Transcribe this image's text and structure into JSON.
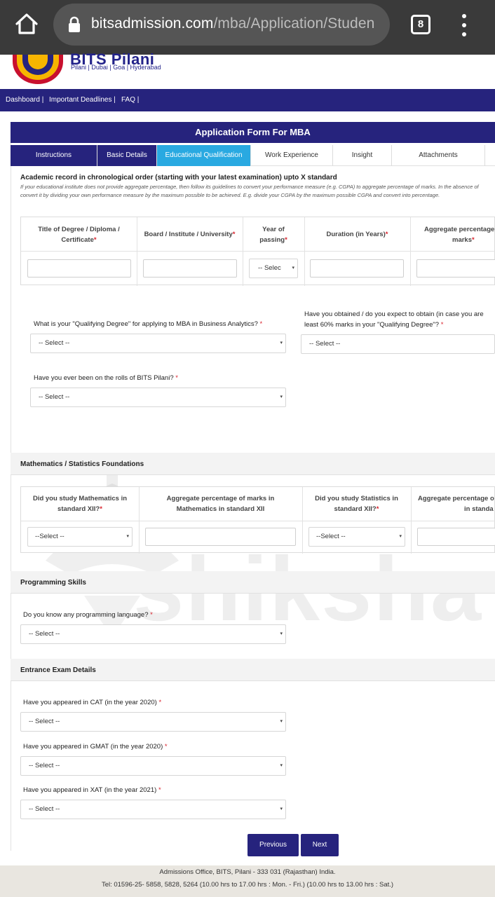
{
  "browser": {
    "url_host": "bitsadmission.com",
    "url_path": "/mba/Application/Studen",
    "tab_count": "8",
    "icons": [
      "home-icon",
      "lock-icon",
      "tabs-icon",
      "menu-icon"
    ]
  },
  "site": {
    "logo_title": "BITS Pilani",
    "logo_sub": "Pilani | Dubai | Goa | Hyderabad",
    "nav": [
      "Dashboard |",
      "Important Deadlines |",
      "FAQ |"
    ]
  },
  "form": {
    "title": "Application Form For MBA",
    "tabs": [
      "Instructions",
      "Basic Details",
      "Educational Qualification",
      "Work Experience",
      "Insight",
      "Attachments"
    ],
    "active_tab": "Educational Qualification"
  },
  "academic": {
    "heading": "Academic record in chronological order (starting with your latest examination) upto X standard",
    "note_line1": "If your educational institute does not provide aggregate percentage, then follow its guidelines to convert your performance measure (e.g. CGPA) to aggregate percentage of marks. In the absence of",
    "note_line2": "convert it by dividing your own performance measure by the maximum possible to be achieved. E.g. divide your CGPA by the maximum possible CGPA and convert into percentage.",
    "columns": [
      {
        "line1": "Title of Degree / Diploma /",
        "line2": "Certificate"
      },
      {
        "line1": "Board / Institute / University",
        "line2": ""
      },
      {
        "line1": "Year of",
        "line2": "passing"
      },
      {
        "line1": "Duration (in Years)",
        "line2": ""
      },
      {
        "line1": "Aggregate percentage",
        "line2": "marks"
      }
    ],
    "year_select": "-- Selec"
  },
  "qualifying": {
    "q1": "What is your \"Qualifying Degree\" for applying to MBA in Business Analytics?",
    "q1_value": "-- Select --",
    "q2_line1": "Have you obtained / do you expect to obtain (in case you are",
    "q2_line2": "least 60% marks in your \"Qualifying Degree\"?",
    "q2_value": "-- Select --",
    "q3": "Have you ever been on the rolls of BITS Pilani?",
    "q3_value": "-- Select --"
  },
  "maths": {
    "heading": "Mathematics / Statistics Foundations",
    "columns": [
      {
        "line1": "Did you study Mathematics in",
        "line2": "standard XII?"
      },
      {
        "line1": "Aggregate percentage of marks in",
        "line2": "Mathematics in standard XII"
      },
      {
        "line1": "Did you study Statistics in",
        "line2": "standard XII?"
      },
      {
        "line1": "Aggregate percentage o",
        "line2": "in standa"
      }
    ],
    "math_value": "--Select --",
    "stat_value": "--Select --"
  },
  "programming": {
    "heading": "Programming Skills",
    "q": "Do you know any programming language?",
    "value": "-- Select --"
  },
  "entrance": {
    "heading": "Entrance Exam Details",
    "cat_q": "Have you appeared in CAT (in the year 2020)",
    "cat_value": "-- Select --",
    "gmat_q": "Have you appeared in GMAT (in the year 2020)",
    "gmat_value": "-- Select --",
    "xat_q": "Have you appeared in XAT (in the year 2021)",
    "xat_value": "-- Select --"
  },
  "buttons": {
    "previous": "Previous",
    "next": "Next"
  },
  "footer": {
    "line1": "Admissions Office, BITS, Pilani - 333 031 (Rajasthan) India.",
    "line2": "Tel: 01596-25- 5858, 5828, 5264 (10.00 hrs to 17.00 hrs : Mon. - Fri.) (10.00 hrs to 13.00 hrs : Sat.)"
  },
  "watermark": {
    "text": "shiksha"
  },
  "required_mark": "*",
  "caret": "▾",
  "colors": {
    "brand": "#26237d",
    "active_tab": "#29a9e1",
    "required": "#d9232d"
  }
}
